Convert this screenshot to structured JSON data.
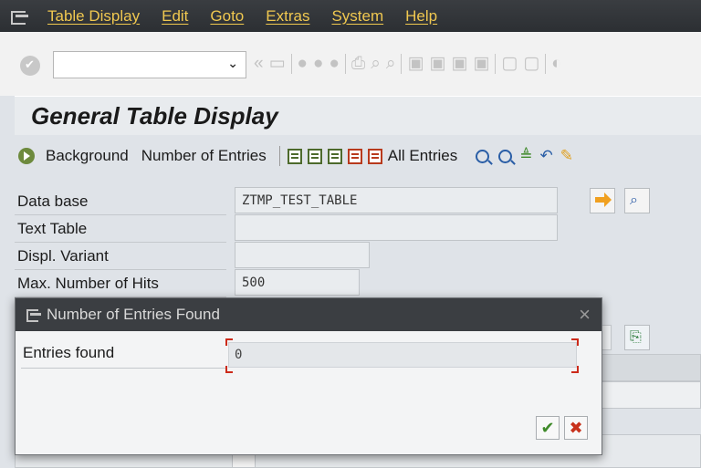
{
  "menubar": {
    "items": [
      {
        "label": "Table Display"
      },
      {
        "label": "Edit"
      },
      {
        "label": "Goto"
      },
      {
        "label": "Extras"
      },
      {
        "label": "System"
      },
      {
        "label": "Help"
      }
    ]
  },
  "toolbar": {
    "command_value": ""
  },
  "title": {
    "text": "General Table Display"
  },
  "app_toolbar": {
    "background_label": "Background",
    "number_of_entries_label": "Number of Entries",
    "all_entries_label": "All Entries"
  },
  "form": {
    "data_base": {
      "label": "Data base",
      "value": "ZTMP_TEST_TABLE"
    },
    "text_table": {
      "label": "Text Table",
      "value": ""
    },
    "displ_variant": {
      "label": "Displ. Variant",
      "value": ""
    },
    "max_hits": {
      "label": "Max. Number of Hits",
      "value": "500"
    }
  },
  "dialog": {
    "title": "Number of Entries Found",
    "close_glyph": "×",
    "entries_found_label": "Entries found",
    "entries_found_value": "0"
  },
  "colors": {
    "menubar_bg": "#2f3236",
    "menu_text": "#f0c850",
    "confirm_green": "#3f8a2a",
    "cancel_red": "#c8321c"
  }
}
